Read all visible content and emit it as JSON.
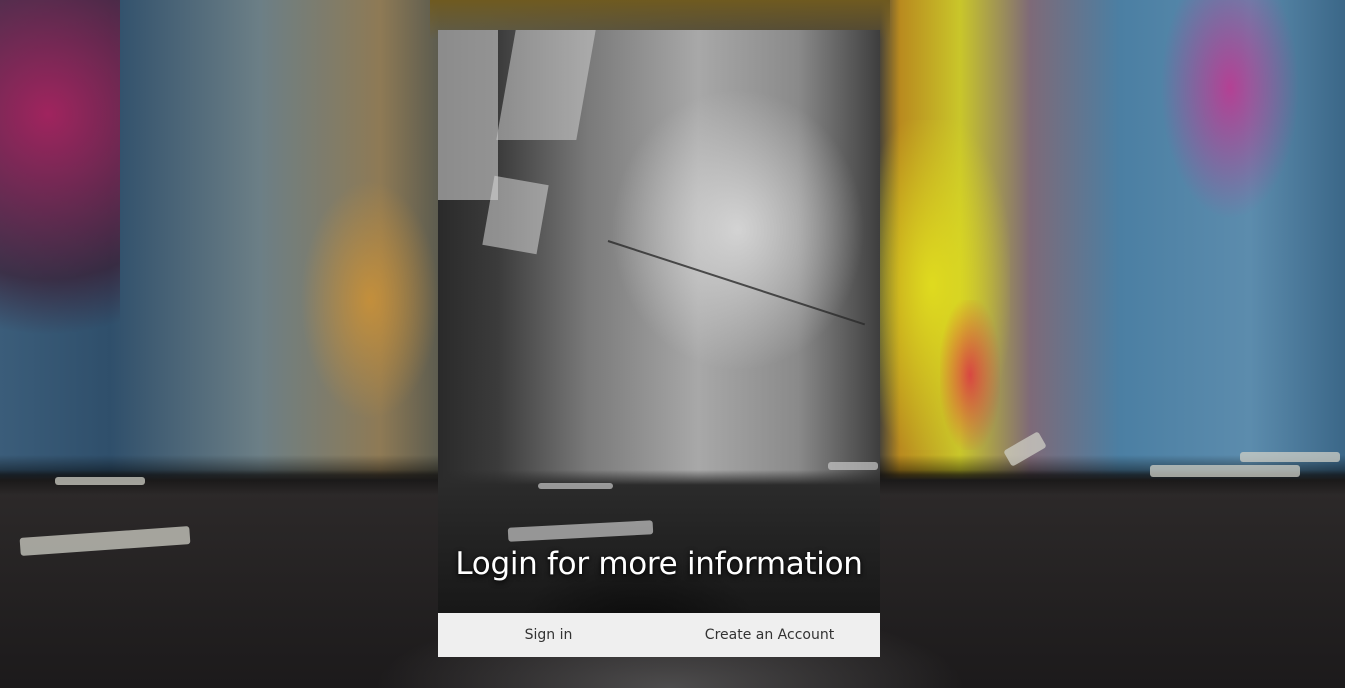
{
  "login_panel": {
    "heading": "Login for more information",
    "actions": {
      "sign_in_label": "Sign in",
      "create_account_label": "Create an Account"
    }
  },
  "colors": {
    "action_bar_bg": "#efefef",
    "action_text": "#333333",
    "heading_text": "#ffffff"
  }
}
